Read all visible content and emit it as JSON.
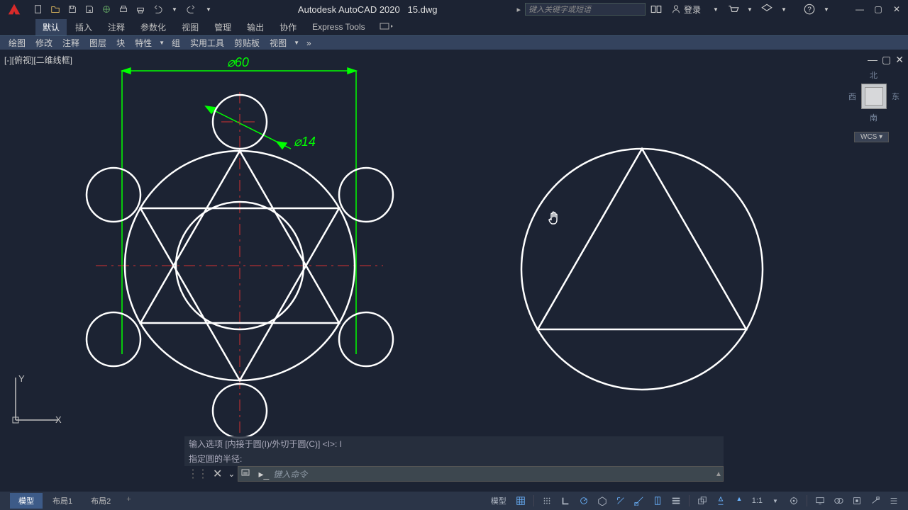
{
  "titlebar": {
    "product": "Autodesk AutoCAD 2020",
    "file": "15.dwg",
    "search_placeholder": "键入关键字或短语",
    "login": "登录"
  },
  "ribbon": {
    "tabs": [
      "默认",
      "插入",
      "注释",
      "参数化",
      "视图",
      "管理",
      "输出",
      "协作",
      "Express Tools"
    ]
  },
  "panels": [
    "绘图",
    "修改",
    "注释",
    "图层",
    "块",
    "特性",
    "组",
    "实用工具",
    "剪贴板",
    "视图"
  ],
  "view_label": "[-][俯视][二维线框]",
  "viewcube": {
    "n": "北",
    "s": "南",
    "e": "东",
    "w": "西",
    "wcs": "WCS"
  },
  "ucs": {
    "x": "X",
    "y": "Y"
  },
  "dims": {
    "d60": "⌀60",
    "d14": "⌀14"
  },
  "cmd": {
    "line1": "输入选项 [内接于圆(I)/外切于圆(C)] <I>: I",
    "line2": "指定圆的半径:",
    "placeholder": "键入命令",
    "recent_btn": "▾"
  },
  "model_tabs": {
    "model": "模型",
    "layout1": "布局1",
    "layout2": "布局2"
  },
  "status": {
    "model": "模型",
    "scale": "1:1"
  },
  "doc_ctl": {
    "min": "—",
    "max": "▢",
    "close": "✕"
  },
  "win_ctl": {
    "min": "—",
    "max": "▢",
    "close": "✕"
  }
}
